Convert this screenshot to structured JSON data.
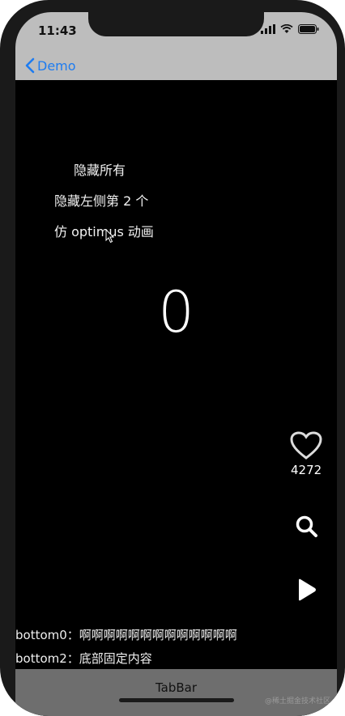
{
  "status_bar": {
    "time": "11:43",
    "icons": [
      "signal-icon",
      "wifi-icon",
      "battery-icon"
    ]
  },
  "nav": {
    "back_label": "Demo",
    "accent_color": "#1e7cf0"
  },
  "menu": {
    "items": [
      "隐藏所有",
      "隐藏左侧第 2 个",
      "仿 optimus 动画"
    ]
  },
  "counter": {
    "value": "0"
  },
  "side_actions": {
    "like_count": "4272",
    "icons": [
      "heart-icon",
      "search-icon",
      "play-icon"
    ]
  },
  "bottom": {
    "line0": "bottom0：啊啊啊啊啊啊啊啊啊啊啊啊啊",
    "line2": "bottom2：底部固定内容"
  },
  "tabbar": {
    "label": "TabBar",
    "watermark": "@稀土掘金技术社区"
  }
}
